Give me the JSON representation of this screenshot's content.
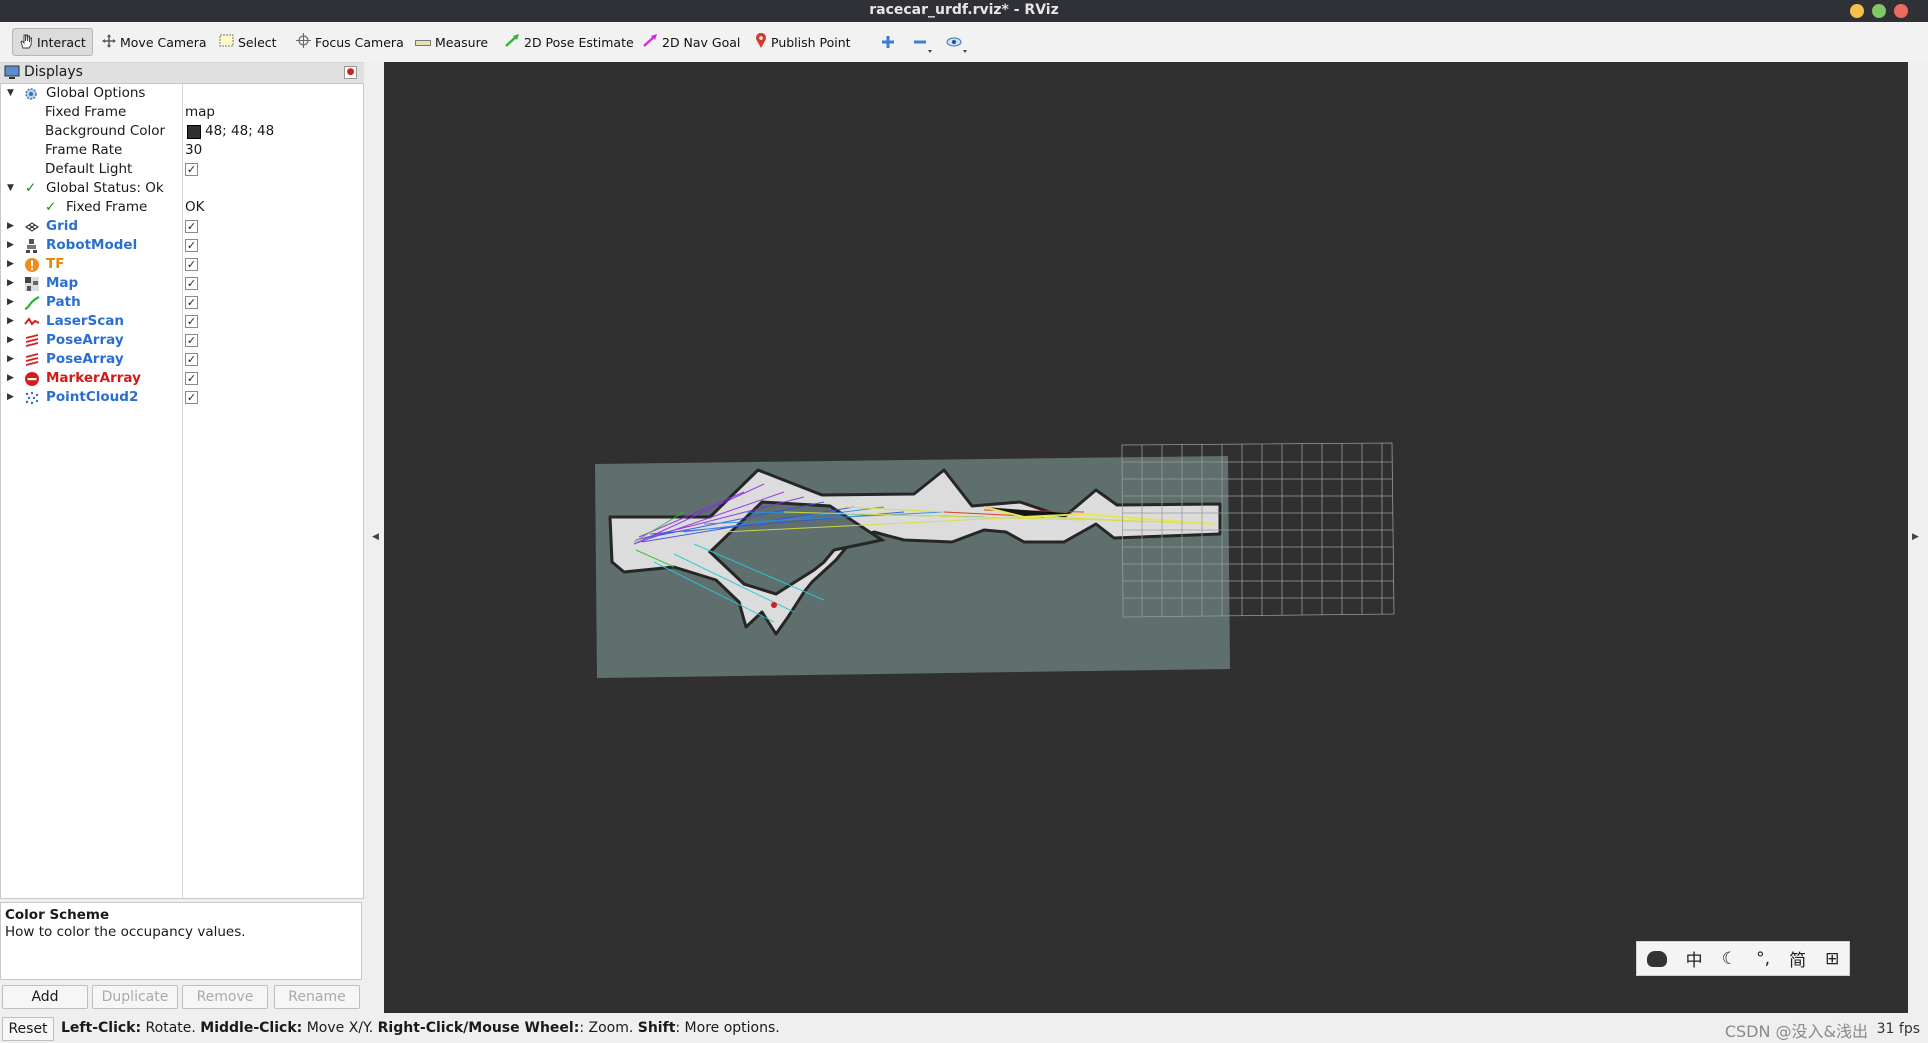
{
  "window": {
    "title": "racecar_urdf.rviz* - RViz"
  },
  "toolbar": {
    "interact": "Interact",
    "move_camera": "Move Camera",
    "select": "Select",
    "focus_camera": "Focus Camera",
    "measure": "Measure",
    "pose_estimate": "2D Pose Estimate",
    "nav_goal": "2D Nav Goal",
    "publish_point": "Publish Point"
  },
  "displays": {
    "header": "Displays",
    "global_options": {
      "label": "Global Options",
      "fixed_frame_label": "Fixed Frame",
      "fixed_frame_value": "map",
      "bg_color_label": "Background Color",
      "bg_color_value": "48; 48; 48",
      "bg_color_swatch": "#303030",
      "frame_rate_label": "Frame Rate",
      "frame_rate_value": "30",
      "default_light_label": "Default Light",
      "default_light_checked": true
    },
    "global_status": {
      "label": "Global Status: Ok",
      "fixed_frame_label": "Fixed Frame",
      "fixed_frame_value": "OK"
    },
    "items": [
      {
        "label": "Grid",
        "icon": "grid-icon",
        "color": "blue",
        "checked": true
      },
      {
        "label": "RobotModel",
        "icon": "robot-icon",
        "color": "blue",
        "checked": true
      },
      {
        "label": "TF",
        "icon": "warning-icon",
        "color": "orange",
        "checked": true
      },
      {
        "label": "Map",
        "icon": "map-icon",
        "color": "blue",
        "checked": true
      },
      {
        "label": "Path",
        "icon": "path-icon",
        "color": "blue",
        "checked": true
      },
      {
        "label": "LaserScan",
        "icon": "laserscan-icon",
        "color": "blue",
        "checked": true
      },
      {
        "label": "PoseArray",
        "icon": "posearray-icon",
        "color": "blue",
        "checked": true
      },
      {
        "label": "PoseArray",
        "icon": "posearray-icon",
        "color": "blue",
        "checked": true
      },
      {
        "label": "MarkerArray",
        "icon": "error-icon",
        "color": "red",
        "checked": true
      },
      {
        "label": "PointCloud2",
        "icon": "pointcloud-icon",
        "color": "blue",
        "checked": true
      }
    ]
  },
  "description": {
    "title": "Color Scheme",
    "text": "How to color the occupancy values."
  },
  "panel_buttons": {
    "add": "Add",
    "duplicate": "Duplicate",
    "remove": "Remove",
    "rename": "Rename"
  },
  "status": {
    "reset": "Reset",
    "hint_lc": "Left-Click:",
    "hint_lc_t": " Rotate. ",
    "hint_mc": "Middle-Click:",
    "hint_mc_t": " Move X/Y. ",
    "hint_rc": "Right-Click/Mouse Wheel:",
    "hint_rc_t": ": Zoom. ",
    "hint_sh": "Shift",
    "hint_sh_t": ": More options.",
    "fps": "31 fps"
  },
  "ime": {
    "zh": "中",
    "punct": "°,",
    "simplified": "简"
  },
  "watermark": "CSDN @没入&浅出",
  "colors": {
    "viewport_bg": "#303030",
    "map_floor": "#5f6f6e",
    "accent_blue": "#2b6fcc"
  }
}
